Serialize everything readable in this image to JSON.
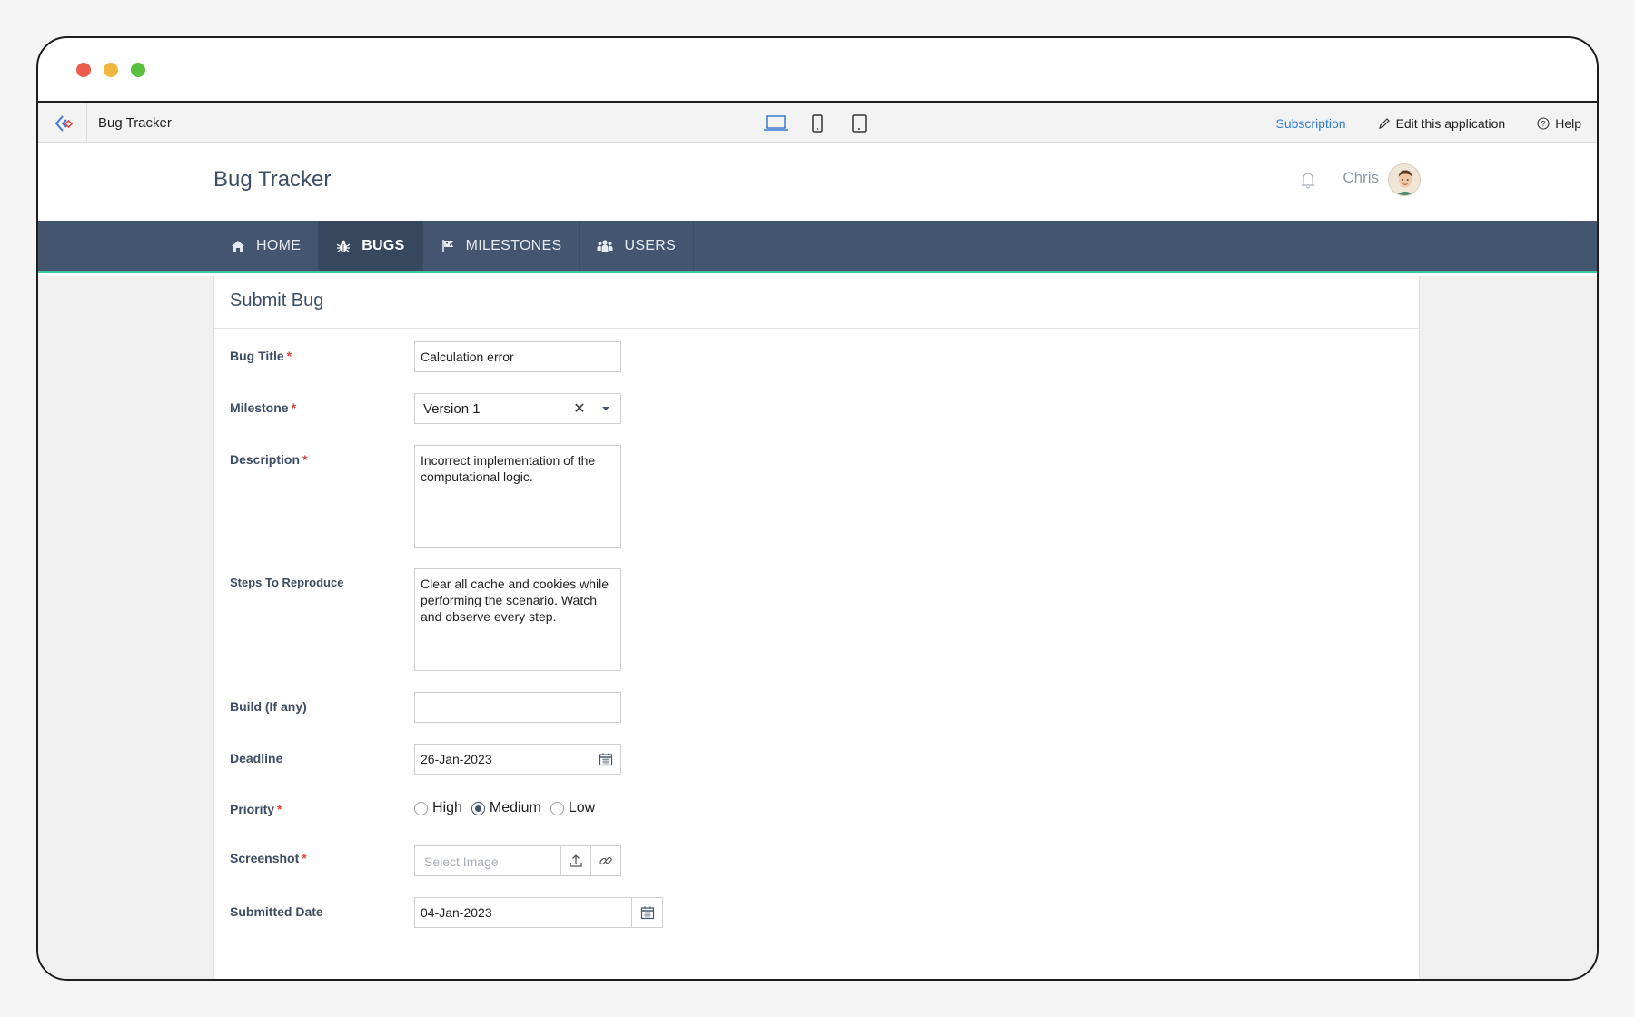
{
  "appbar": {
    "app_name": "Bug Tracker",
    "subscription": "Subscription",
    "edit_app": "Edit this application",
    "help": "Help"
  },
  "header": {
    "title": "Bug Tracker",
    "user_name": "Chris"
  },
  "nav": {
    "items": [
      {
        "label": "HOME",
        "icon": "home-icon"
      },
      {
        "label": "BUGS",
        "icon": "bug-icon",
        "active": true
      },
      {
        "label": "MILESTONES",
        "icon": "flag-icon"
      },
      {
        "label": "USERS",
        "icon": "users-icon"
      }
    ]
  },
  "form": {
    "title": "Submit Bug",
    "bug_title": {
      "label": "Bug Title",
      "required": "*",
      "value": "Calculation error"
    },
    "milestone": {
      "label": "Milestone",
      "required": "*",
      "value": "Version 1",
      "clear": "✕"
    },
    "description": {
      "label": "Description",
      "required": "*",
      "value": "Incorrect implementation of the computational logic."
    },
    "steps": {
      "label": "Steps To Reproduce",
      "value": "Clear all cache and cookies while performing the scenario. Watch and observe every step."
    },
    "build": {
      "label": "Build (If any)",
      "value": ""
    },
    "deadline": {
      "label": "Deadline",
      "value": "26-Jan-2023"
    },
    "priority": {
      "label": "Priority",
      "required": "*",
      "options": [
        "High",
        "Medium",
        "Low"
      ],
      "selected": "Medium"
    },
    "screenshot": {
      "label": "Screenshot",
      "required": "*",
      "placeholder": "Select Image"
    },
    "submitted_date": {
      "label": "Submitted Date",
      "value": "04-Jan-2023"
    }
  },
  "colors": {
    "navbar": "#44566f",
    "nav_accent": "#3fc6a0",
    "link": "#2f7bd3",
    "required": "#e0463e",
    "submit": "#5ec39b"
  }
}
